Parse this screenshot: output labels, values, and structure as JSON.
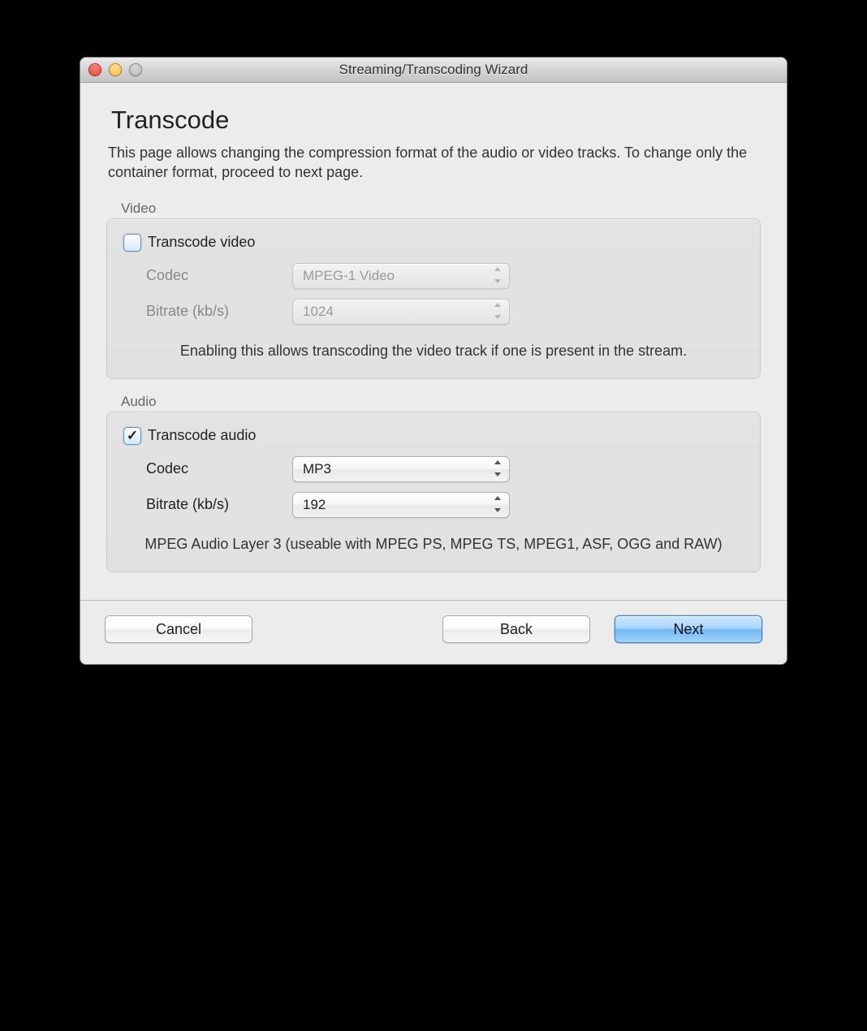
{
  "window": {
    "title": "Streaming/Transcoding Wizard"
  },
  "page": {
    "heading": "Transcode",
    "description": "This page allows changing the compression format of the audio or video tracks. To change only the container format, proceed to next page."
  },
  "video": {
    "group_label": "Video",
    "checkbox_label": "Transcode video",
    "checked": false,
    "codec_label": "Codec",
    "codec_value": "MPEG-1 Video",
    "bitrate_label": "Bitrate (kb/s)",
    "bitrate_value": "1024",
    "hint": "Enabling this allows transcoding the video track if one is present in the stream."
  },
  "audio": {
    "group_label": "Audio",
    "checkbox_label": "Transcode audio",
    "checked": true,
    "codec_label": "Codec",
    "codec_value": "MP3",
    "bitrate_label": "Bitrate (kb/s)",
    "bitrate_value": "192",
    "hint": "MPEG Audio Layer 3 (useable with MPEG PS, MPEG TS, MPEG1, ASF, OGG and RAW)"
  },
  "buttons": {
    "cancel": "Cancel",
    "back": "Back",
    "next": "Next"
  }
}
